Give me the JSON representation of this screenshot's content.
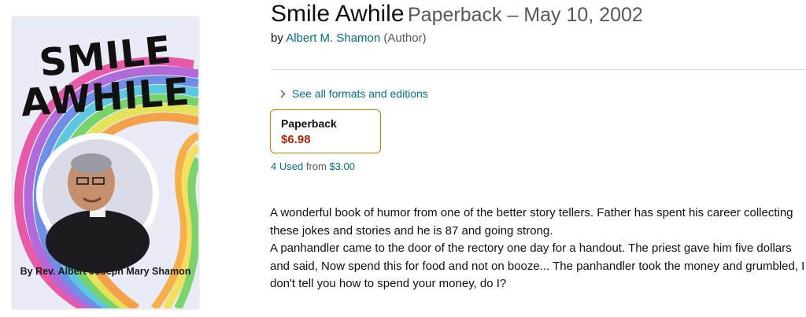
{
  "product": {
    "title": "Smile Awhile",
    "format_date": "Paperback – May 10, 2002",
    "by_label": "by",
    "author": "Albert M. Shamon",
    "author_role": "(Author)"
  },
  "cover": {
    "title_line1": "SMILE",
    "title_line2": "AWHILE",
    "author_text": "By Rev. Albert Joseph Mary Shamon"
  },
  "formats": {
    "see_all_label": "See all formats and editions",
    "selected": {
      "name": "Paperback",
      "price": "$6.98"
    },
    "used": {
      "count_text": "4 Used",
      "from_label": "from",
      "price": "$3.00"
    }
  },
  "description": {
    "paragraph1": "A wonderful book of humor from one of the better story tellers. Father has spent his career collecting these jokes and stories and he is 87 and going strong.",
    "paragraph2": "A panhandler came to the door of the rectory one day for a handout. The priest gave him five dollars and said, Now spend this for food and not on booze... The panhandler took the money and grumbled, I don't tell you how to spend your money, do I?"
  },
  "colors": {
    "link": "#007185",
    "price": "#b12704",
    "selected_border": "#e77600",
    "text": "#0f1111"
  }
}
